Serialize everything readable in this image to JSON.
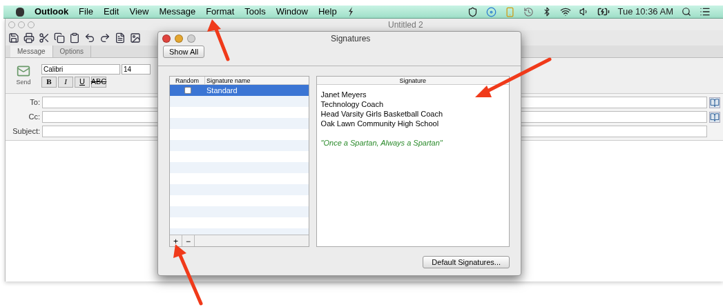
{
  "menu_bar": {
    "app_name": "Outlook",
    "items": [
      "File",
      "Edit",
      "View",
      "Message",
      "Format",
      "Tools",
      "Window",
      "Help"
    ],
    "clock": "Tue 10:36 AM"
  },
  "window": {
    "title": "Untitled 2",
    "tabs": [
      {
        "label": "Message",
        "selected": true
      },
      {
        "label": "Options",
        "selected": false
      }
    ],
    "ribbon": {
      "send_label": "Send",
      "font": "Calibri",
      "size": "14",
      "format_buttons": [
        "B",
        "I",
        "U",
        "ABC"
      ]
    },
    "fields": [
      {
        "label": "To:",
        "address_book": true
      },
      {
        "label": "Cc:",
        "address_book": true
      },
      {
        "label": "Subject:",
        "address_book": false
      }
    ]
  },
  "dialog": {
    "title": "Signatures",
    "show_all": "Show All",
    "columns": [
      "Random",
      "Signature name"
    ],
    "signatures": [
      {
        "name": "Standard",
        "random": false,
        "selected": true
      }
    ],
    "signature_heading": "Signature",
    "signature_lines": [
      {
        "text": "Janet Meyers",
        "kind": "plain"
      },
      {
        "text": "Technology Coach",
        "kind": "plain"
      },
      {
        "text": "Head Varsity Girls Basketball Coach",
        "kind": "plain"
      },
      {
        "text": "Oak Lawn Community High School",
        "kind": "plain"
      },
      {
        "text": "\"Once a Spartan, Always a Spartan\"",
        "kind": "quote"
      }
    ],
    "add": "+",
    "remove": "−",
    "default_button": "Default Signatures..."
  }
}
